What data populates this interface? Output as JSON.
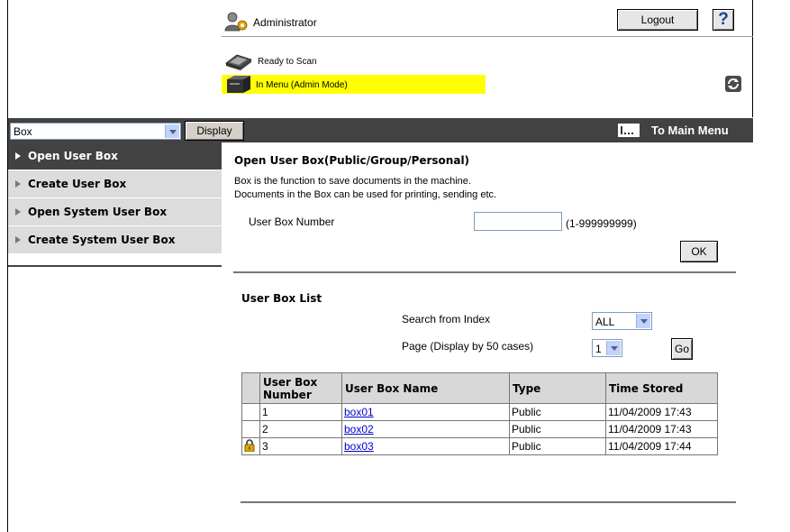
{
  "header": {
    "user": "Administrator",
    "logout_label": "Logout",
    "help_label": "?",
    "status_scan": "Ready to Scan",
    "status_menu": "In Menu (Admin Mode)"
  },
  "toolbar": {
    "category_value": "Box",
    "display_label": "Display",
    "main_menu_label": "To Main Menu"
  },
  "sidebar": {
    "items": [
      {
        "label": "Open User Box"
      },
      {
        "label": "Create User Box"
      },
      {
        "label": "Open System User Box"
      },
      {
        "label": "Create System User Box"
      }
    ]
  },
  "main": {
    "title": "Open User Box(Public/Group/Personal)",
    "desc1": "Box is the function to save documents in the machine.",
    "desc2": "Documents in the Box can be used for printing, sending etc.",
    "box_number_label": "User Box Number",
    "box_number_value": "",
    "box_number_range": "(1-999999999)",
    "ok_label": "OK"
  },
  "list": {
    "title": "User Box List",
    "search_label": "Search from Index",
    "search_value": "ALL",
    "page_label": "Page (Display by 50 cases)",
    "page_value": "1",
    "go_label": "Go",
    "columns": [
      "User Box Number",
      "User Box Name",
      "Type",
      "Time Stored"
    ],
    "rows": [
      {
        "number": "1",
        "name": "box01",
        "type": "Public",
        "time": "11/04/2009 17:43"
      },
      {
        "number": "2",
        "name": "box02",
        "type": "Public",
        "time": "11/04/2009 17:43"
      },
      {
        "number": "3",
        "name": "box03",
        "type": "Public",
        "time": "11/04/2009 17:44"
      }
    ]
  },
  "icons": {
    "user": "admin-user-icon",
    "scanner": "scanner-icon",
    "machine": "machine-icon",
    "refresh": "refresh-icon",
    "main_menu": "main-menu-icon",
    "lock": "lock-icon"
  },
  "colors": {
    "bar": "#424242",
    "status_highlight": "#ffff00",
    "link": "#0000cc",
    "sidebar_inactive": "#dcdcdc"
  }
}
